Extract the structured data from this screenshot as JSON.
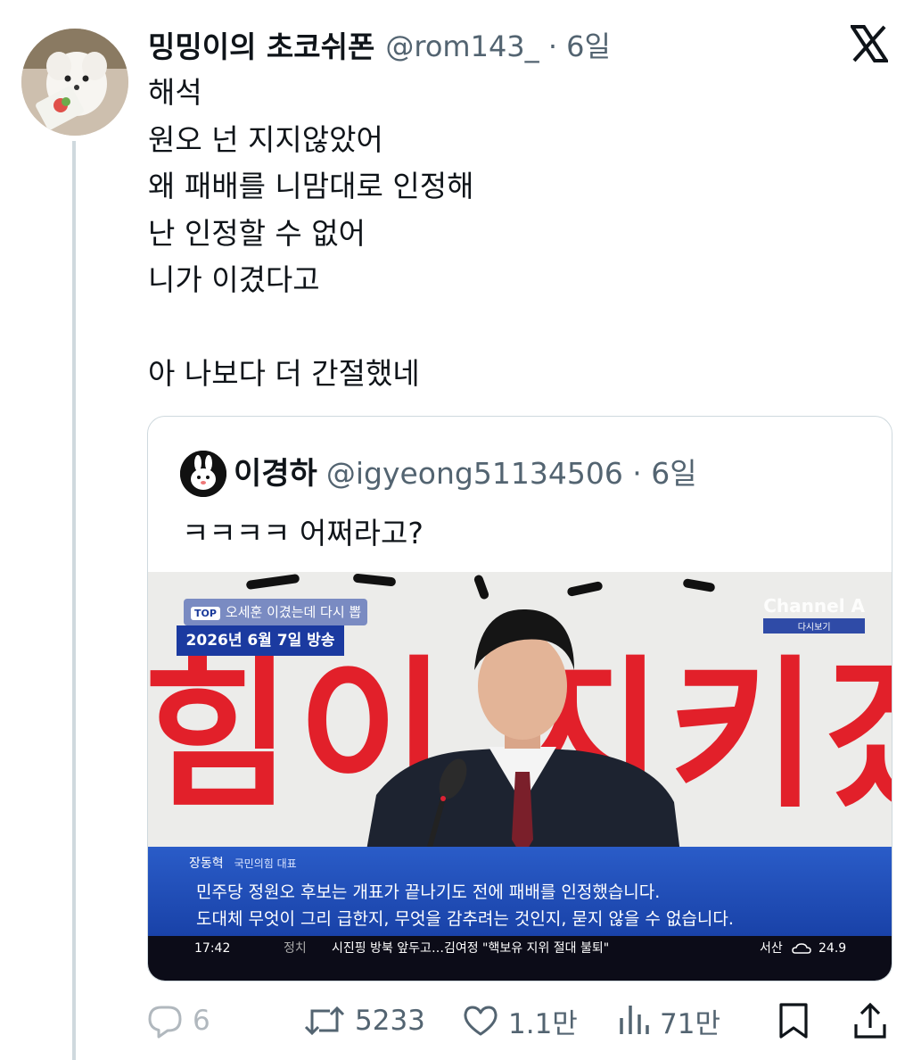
{
  "tweet": {
    "author": {
      "name": "밍밍이의 초코쉬폰",
      "handle_time": "@rom143_ · 6일"
    },
    "lines": [
      "해석",
      "원오 넌 지지않았어",
      "왜 패배를 니맘대로 인정해",
      "난 인정할 수 없어",
      "니가 이겼다고",
      "",
      "아 나보다 더 간절했네"
    ]
  },
  "quote": {
    "author": {
      "name": "이경하",
      "handle_time": "@igyeong51134506 · 6일"
    },
    "text": "ㅋㅋㅋㅋ 어쩌라고?",
    "media": {
      "banner_text": "힘이 지키겠습",
      "top_badge": "TOP",
      "top_label": "오세훈 이겼는데 다시 뽑자?",
      "air_date": "2026년 6월 7일 방송",
      "channel": "Channel A",
      "channel_sub": "다시보기",
      "speaker_name": "장동혁",
      "speaker_role": "국민의힘 대표",
      "caption_line1": "민주당 정원오 후보는 개표가 끝나기도 전에 패배를 인정했습니다.",
      "caption_line2": "도대체 무엇이 그리 급한지, 무엇을 감추려는 것인지, 묻지 않을 수 없습니다.",
      "ticker_time": "17:42",
      "ticker_category": "정치",
      "ticker_headline": "시진핑 방북 앞두고…김여정 \"핵보유 지위 절대 불퇴\"",
      "ticker_region": "서산",
      "ticker_temp": "24.9"
    }
  },
  "actions": {
    "replies": "6",
    "retweets": "5233",
    "likes": "1.1만",
    "views": "71만"
  },
  "colors": {
    "text": "#0f1419",
    "secondary": "#536471",
    "border": "#cfd9de",
    "banner_red": "#e2202a",
    "caption_blue": "#2a5cc8"
  }
}
